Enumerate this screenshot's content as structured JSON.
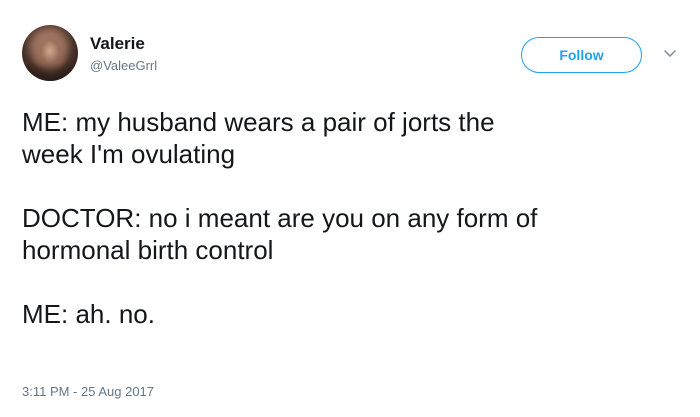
{
  "author": {
    "display_name": "Valerie",
    "username": "@ValeeGrrl"
  },
  "actions": {
    "follow_label": "Follow",
    "menu_icon": "chevron-down-icon"
  },
  "tweet": {
    "lines": {
      "l1": "ME: my husband wears a pair of jorts the",
      "l2": "week I'm ovulating",
      "l3": "DOCTOR: no i meant are you on any form of",
      "l4": "hormonal birth control",
      "l5": "ME: ah. no."
    },
    "timestamp": "3:11 PM - 25 Aug 2017"
  },
  "colors": {
    "accent": "#1da1f2",
    "text": "#14171a",
    "muted": "#657786"
  }
}
